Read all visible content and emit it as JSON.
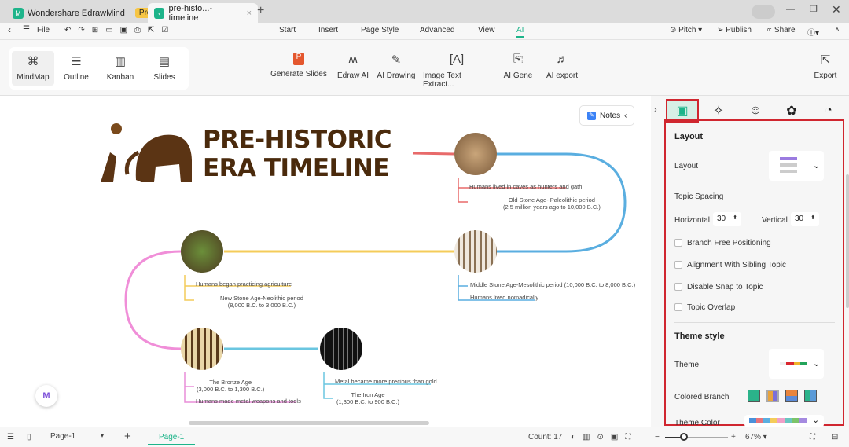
{
  "app": {
    "name": "Wondershare EdrawMind",
    "badge": "Pro",
    "doc_tab": "pre-histo...-timeline"
  },
  "menu": {
    "file": "File",
    "tabs": [
      "Start",
      "Insert",
      "Page Style",
      "Advanced",
      "View",
      "AI"
    ],
    "active_tab": "AI",
    "right": [
      "Pitch",
      "Publish",
      "Share"
    ]
  },
  "ribbon": {
    "views": [
      "MindMap",
      "Outline",
      "Kanban",
      "Slides"
    ],
    "ai_tools": [
      "Generate Slides",
      "Edraw AI",
      "AI Drawing",
      "Image Text Extract...",
      "AI Gene",
      "AI export"
    ],
    "export": "Export"
  },
  "canvas": {
    "title_line1": "PRE-HISTORIC",
    "title_line2": "ERA TIMELINE",
    "notes": "Notes",
    "nodes": {
      "paleo_fact": "Humans lived in caves as hunters and gath",
      "paleo_title": "Old Stone Age- Paleolithic period",
      "paleo_date": "(2.5 million years ago to 10,000 B.C.)",
      "meso_title": "Middle Stone Age-Mesolithic period (10,000 B.C. to 8,000 B.C.)",
      "meso_fact": "Humans lived nomadically",
      "neo_fact": "Humans began practicing agriculture",
      "neo_title": "New Stone Age-Neolithic period",
      "neo_date": "(8,000 B.C. to 3,000 B.C.)",
      "bronze_title": "The Bronze Age",
      "bronze_date": "(3,000 B.C. to 1,300 B.C.)",
      "bronze_fact": "Humans made metal weapons and tools",
      "iron_fact": "Metal became more precious than gold",
      "iron_title": "The Iron Age",
      "iron_date": "(1,300 B.C. to 900 B.C.)"
    }
  },
  "panel": {
    "layout_heading": "Layout",
    "layout_label": "Layout",
    "topic_spacing": "Topic Spacing",
    "horizontal_label": "Horizontal",
    "horizontal": "30",
    "vertical_label": "Vertical",
    "vertical": "30",
    "checks": [
      "Branch Free Positioning",
      "Alignment With Sibling Topic",
      "Disable Snap to Topic",
      "Topic Overlap"
    ],
    "theme_heading": "Theme style",
    "theme_label": "Theme",
    "colored_branch": "Colored Branch",
    "theme_color": "Theme Color"
  },
  "status": {
    "page_select": "Page-1",
    "page_tab": "Page-1",
    "count": "Count: 17",
    "zoom": "67%",
    "zoom_fraction": 0.3
  },
  "colors": {
    "accent": "#1db48a",
    "highlight": "#d0262f"
  }
}
